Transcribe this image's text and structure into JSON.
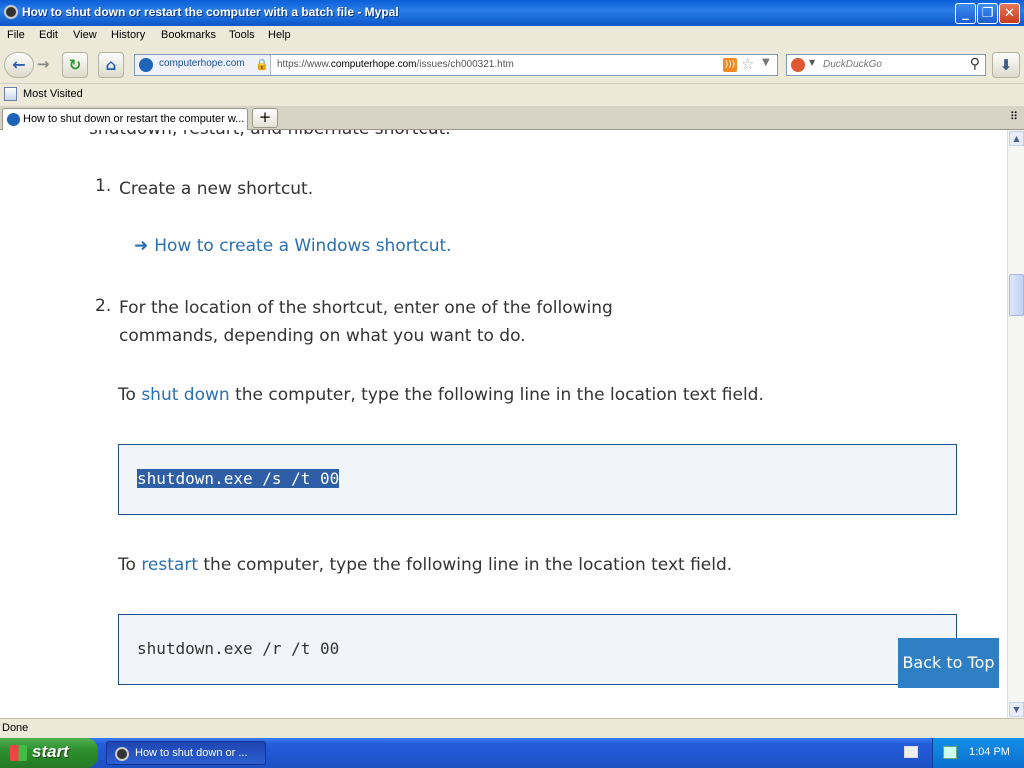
{
  "window": {
    "title": "How to shut down or restart the computer with a batch file - Mypal",
    "controls": {
      "minimize": "_",
      "maximize": "❐",
      "close": "✕"
    }
  },
  "menu": [
    "File",
    "Edit",
    "View",
    "History",
    "Bookmarks",
    "Tools",
    "Help"
  ],
  "nav": {
    "identity_domain": "computerhope.com",
    "url_prefix": "https://www.",
    "url_domain": "computerhope.com",
    "url_path": "/issues/ch000321.htm",
    "search_placeholder": "DuckDuckGo"
  },
  "bookmarks": {
    "most_visited": "Most Visited"
  },
  "tabs": [
    {
      "label": "How to shut down or restart the computer w..."
    }
  ],
  "content": {
    "cut_text": "shutdown, restart, and hibernate shortcut.",
    "step1_num": "1.",
    "step1_text": "Create a new shortcut.",
    "step1_link": "How to create a Windows shortcut.",
    "step2_num": "2.",
    "step2_line1": "For the location of the shortcut, enter one of the following",
    "step2_line2": "commands, depending on what you want to do.",
    "shutdown_pre": "To ",
    "shutdown_link": "shut down",
    "shutdown_post": " the computer, type the following line in the location text field.",
    "shutdown_code": "shutdown.exe /s /t 00",
    "restart_pre": "To ",
    "restart_link": "restart",
    "restart_post": " the computer, type the following line in the location text field.",
    "restart_code": "shutdown.exe /r /t 00",
    "back_to_top": "Back to Top"
  },
  "status": {
    "text": "Done"
  },
  "taskbar": {
    "start_label": "start",
    "task_label": "How to shut down or ...",
    "clock": "1:04 PM"
  },
  "colors": {
    "link": "#2a6fb0",
    "code_bg": "#f1f4f8",
    "code_border": "#1e4f8a",
    "back_to_top_bg": "#2f7fc4",
    "selection": "#2d5ea6"
  }
}
